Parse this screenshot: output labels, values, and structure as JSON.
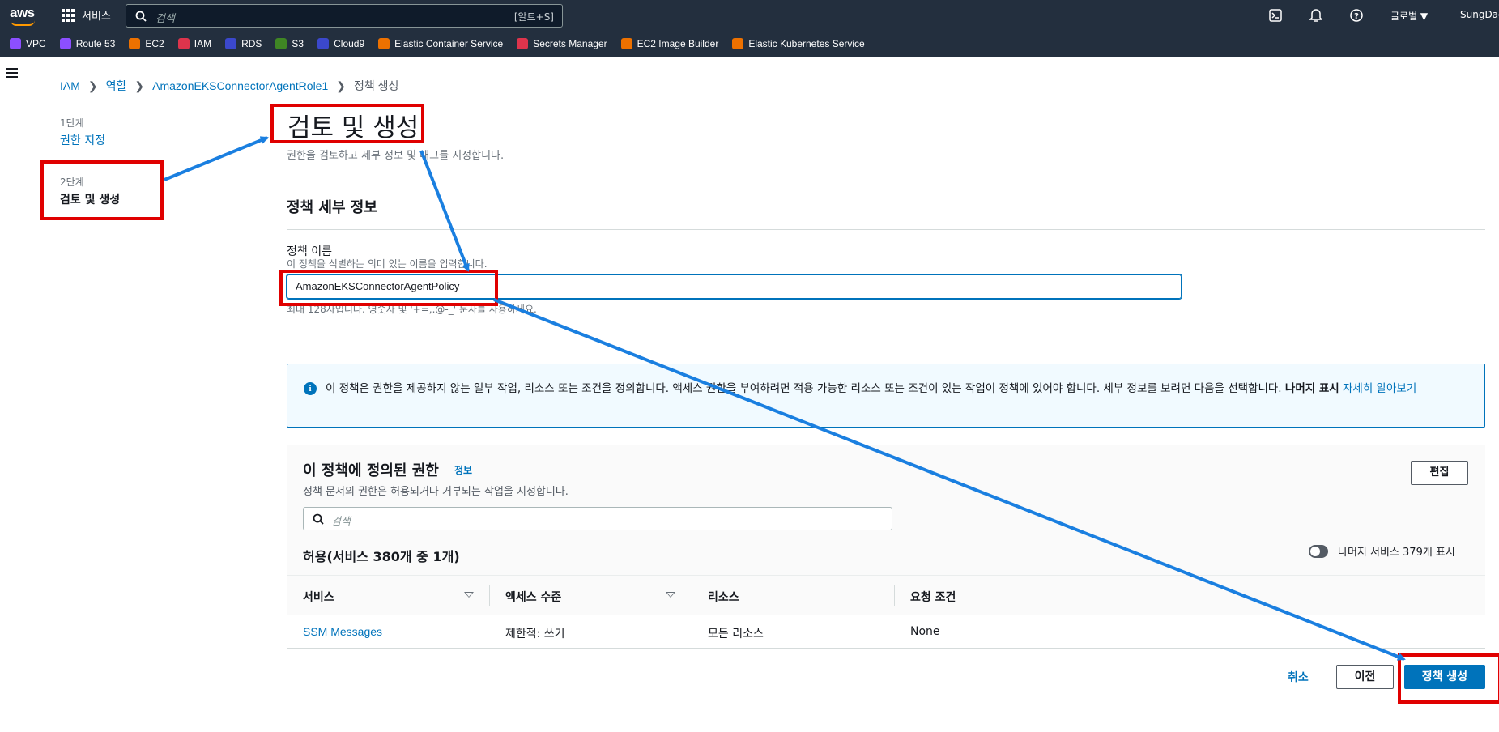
{
  "topbar": {
    "logo": "aws",
    "services_label": "서비스",
    "search_placeholder": "검색",
    "search_shortcut": "[알트+S]",
    "region_label": "글로벌 ▼",
    "account_label": "SungDae"
  },
  "favorites": [
    {
      "label": "VPC",
      "color": "#8c4fff"
    },
    {
      "label": "Route 53",
      "color": "#8c4fff"
    },
    {
      "label": "EC2",
      "color": "#ed7100"
    },
    {
      "label": "IAM",
      "color": "#dd344c"
    },
    {
      "label": "RDS",
      "color": "#3b48cc"
    },
    {
      "label": "S3",
      "color": "#3f8624"
    },
    {
      "label": "Cloud9",
      "color": "#3b48cc"
    },
    {
      "label": "Elastic Container Service",
      "color": "#ed7100"
    },
    {
      "label": "Secrets Manager",
      "color": "#dd344c"
    },
    {
      "label": "EC2 Image Builder",
      "color": "#ed7100"
    },
    {
      "label": "Elastic Kubernetes Service",
      "color": "#ed7100"
    }
  ],
  "breadcrumb": {
    "items": [
      "IAM",
      "역할",
      "AmazonEKSConnectorAgentRole1"
    ],
    "current": "정책 생성"
  },
  "steps": [
    {
      "num": "1단계",
      "label": "권한 지정"
    },
    {
      "num": "2단계",
      "label": "검토 및 생성"
    }
  ],
  "page": {
    "title": "검토 및 생성",
    "subtitle": "권한을 검토하고 세부 정보 및 태그를 지정합니다.",
    "details_heading": "정책 세부 정보",
    "name_label": "정책 이름",
    "name_description": "이 정책을 식별하는 의미 있는 이름을 입력합니다.",
    "name_value": "AmazonEKSConnectorAgentPolicy",
    "name_constraint": "최대 128자입니다. 영숫자 및 '+=,.@-_' 문자를 사용하세요."
  },
  "info_alert": {
    "text": "이 정책은 권한을 제공하지 않는 일부 작업, 리소스 또는 조건을 정의합니다. 액세스 권한을 부여하려면 적용 가능한 리소스 또는 조건이 있는 작업이 정책에 있어야 합니다. 세부 정보를 보려면 다음을 선택합니다.",
    "bold": "나머지 표시",
    "link": "자세히 알아보기"
  },
  "permissions": {
    "title": "이 정책에 정의된 권한",
    "info_link": "정보",
    "description": "정책 문서의 권한은 허용되거나 거부되는 작업을 지정합니다.",
    "edit_label": "편집",
    "search_placeholder": "검색",
    "allow_title": "허용(서비스 380개 중 1개)",
    "toggle_label": "나머지 서비스 379개 표시",
    "columns": [
      "서비스",
      "액세스 수준",
      "리소스",
      "요청 조건"
    ],
    "rows": [
      {
        "service": "SSM Messages",
        "access": "제한적: 쓰기",
        "resource": "모든 리소스",
        "condition": "None"
      }
    ]
  },
  "footer": {
    "cancel": "취소",
    "previous": "이전",
    "create": "정책 생성"
  },
  "colors": {
    "nav_bg": "#232f3e",
    "link": "#0073bb",
    "primary_button": "#0073bb",
    "annotation_box": "#e00000",
    "annotation_arrow": "#1a7fe0"
  }
}
